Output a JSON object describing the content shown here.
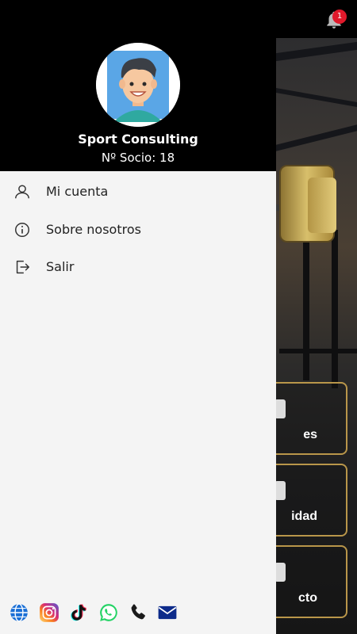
{
  "notifications": {
    "count": "1",
    "icon": "bell-icon",
    "badge_color": "#e0192b"
  },
  "drawer": {
    "user": {
      "name": "Sport Consulting",
      "member_line": "Nº Socio: 18"
    },
    "menu": [
      {
        "label": "Mi cuenta",
        "icon": "user-icon"
      },
      {
        "label": "Sobre nosotros",
        "icon": "info-icon"
      },
      {
        "label": "Salir",
        "icon": "logout-icon"
      }
    ],
    "socials": [
      "globe-icon",
      "instagram-icon",
      "tiktok-icon",
      "whatsapp-icon",
      "phone-icon",
      "mail-icon"
    ]
  },
  "background_cards": [
    {
      "label": "es"
    },
    {
      "label": "idad"
    },
    {
      "label": "cto"
    }
  ],
  "colors": {
    "drawer_bg": "#f4f4f4",
    "header_bg": "#000000",
    "card_border": "#b9964a"
  }
}
